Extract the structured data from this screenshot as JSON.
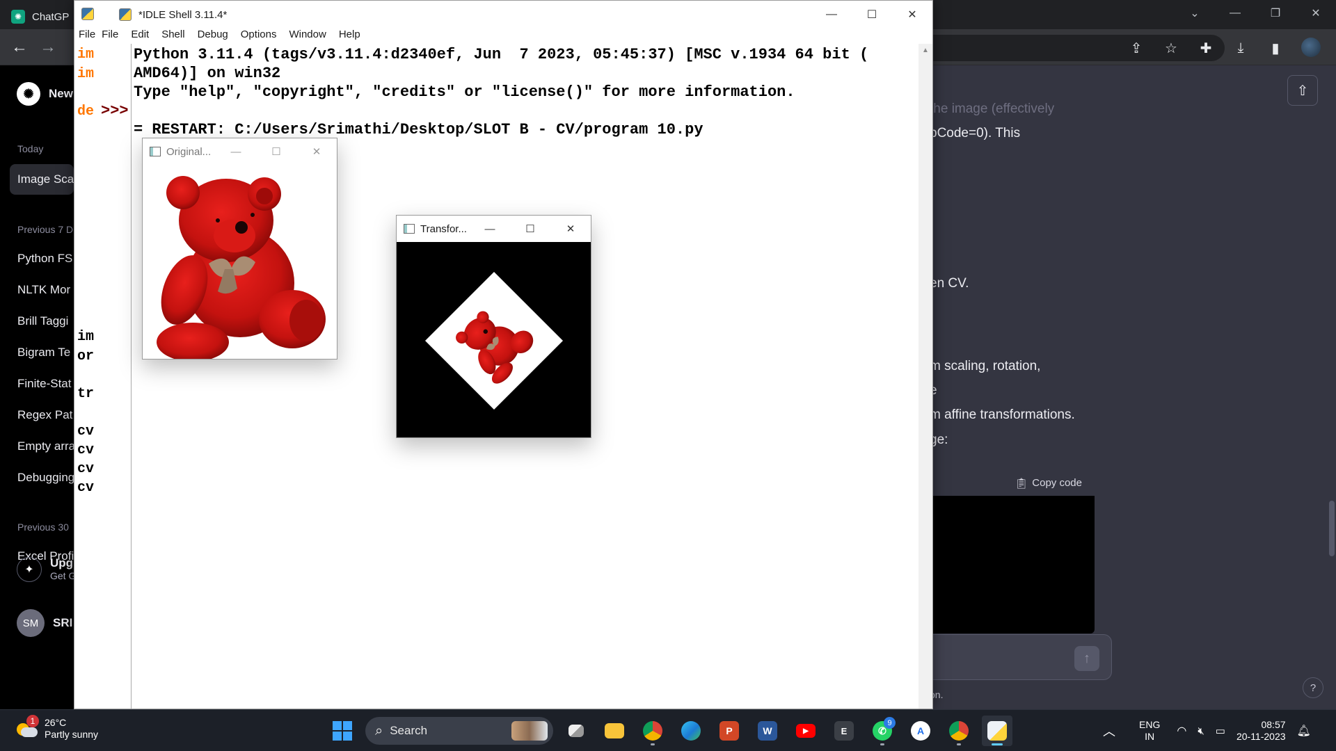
{
  "browser": {
    "tab_title": "ChatGP",
    "sidebar": {
      "new_chat": "New",
      "today_head": "Today",
      "today_item": "Image Sca",
      "prev7_head": "Previous 7 D",
      "prev7_items": [
        "Python FS",
        "NLTK Mor",
        "Brill Taggi",
        "Bigram Te",
        "Finite-Stat",
        "Regex Pat",
        "Empty arra",
        "Debugging"
      ],
      "prev30_head": "Previous 30",
      "prev30_items": [
        "Excel Profi"
      ],
      "upgrade_title": "Upg",
      "upgrade_sub": "Get G",
      "user_initials": "SM",
      "user_name": "SRI"
    },
    "chat_fragments": {
      "line1": "the image (effectively",
      "line2": "pCode=0). This",
      "line3": "en CV.",
      "line4": "m scaling, rotation,",
      "line5": "e",
      "line6": "m affine transformations.",
      "line7": "ge:",
      "copy_code": "Copy code",
      "footer": "on.",
      "help": "?"
    }
  },
  "editor_sliver": {
    "chars": [
      "im",
      "im",
      "de",
      "im",
      "or",
      "tr",
      "cv",
      "cv",
      "cv",
      "cv"
    ]
  },
  "idle": {
    "title": "*IDLE Shell 3.11.4*",
    "menu": [
      "File",
      "File",
      "Edit",
      "Shell",
      "Debug",
      "Options",
      "Window",
      "Help"
    ],
    "prompt": ">>>",
    "lines": [
      "Python 3.11.4 (tags/v3.11.4:d2340ef, Jun  7 2023, 05:45:37) [MSC v.1934 64 bit (",
      "AMD64)] on win32",
      "Type \"help\", \"copyright\", \"credits\" or \"license()\" for more information.",
      "",
      "= RESTART: C:/Users/Srimathi/Desktop/SLOT B - CV/program 10.py"
    ]
  },
  "cv_windows": {
    "original_title": "Original...",
    "transformed_title": "Transfor..."
  },
  "taskbar": {
    "temperature": "26°C",
    "weather": "Partly sunny",
    "weather_badge": "1",
    "search_label": "Search",
    "whatsapp_badge": "9",
    "lang_top": "ENG",
    "lang_bottom": "IN",
    "time": "08:57",
    "date": "20-11-2023"
  }
}
